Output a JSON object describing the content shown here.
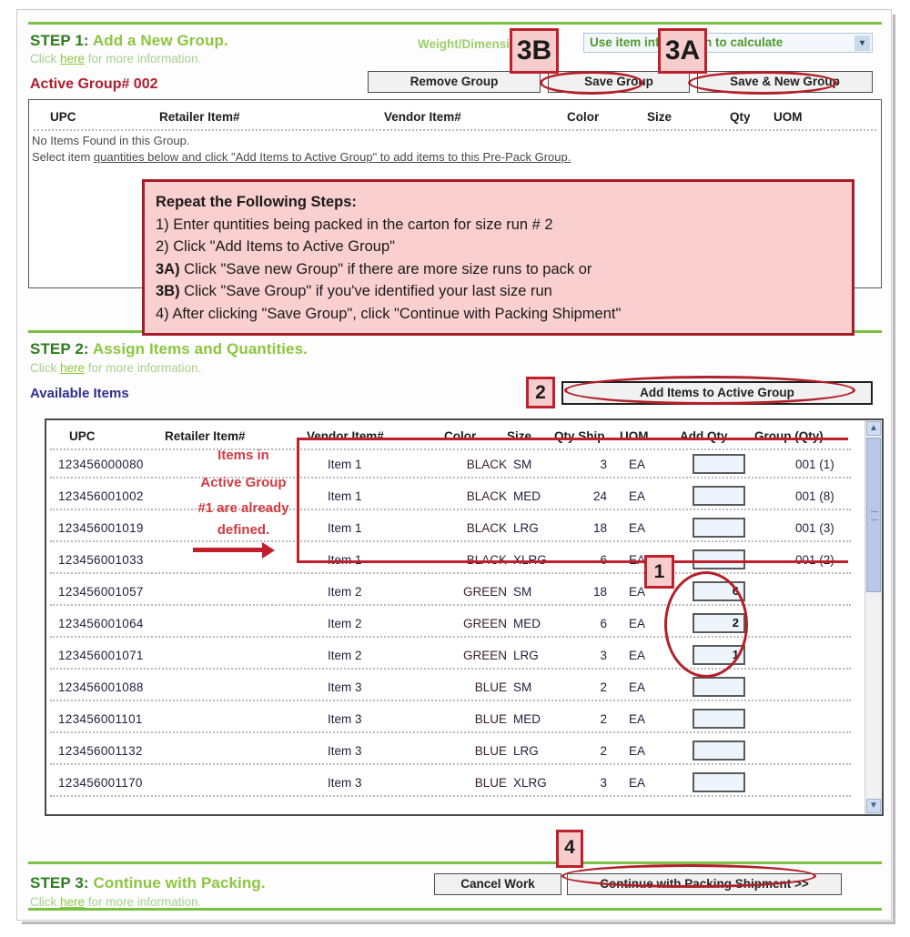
{
  "step1": {
    "heading_prefix": "STEP 1:",
    "heading_text": "Add a New Group.",
    "sub_prefix": "Click ",
    "sub_link": "here",
    "sub_suffix": " for more information.",
    "active_group_label": "Active Group# 002",
    "weight_dims_label": "Weight/Dimensions:",
    "weight_dims_value": "Use item information to calculate",
    "dropdown_arrow": "✓",
    "buttons": {
      "remove_group": "Remove Group",
      "save_group": "Save Group",
      "save_new_group": "Save & New Group"
    },
    "group_table": {
      "columns": [
        "UPC",
        "Retailer Item#",
        "Vendor Item#",
        "Color",
        "Size",
        "Qty",
        "UOM"
      ],
      "empty_line1": "No Items Found in this Group.",
      "empty_line2_a": "Select item ",
      "empty_line2_b": "quantities below and click \"Add Items to Active Group\" to add items to this Pre-Pack Group."
    }
  },
  "callout": {
    "title": "Repeat the Following Steps:",
    "lines": [
      {
        "bold": "1)",
        "text": " Enter quntities being packed in the carton for size run # 2"
      },
      {
        "bold": "2)",
        "text": " Click \"Add Items to Active Group\""
      },
      {
        "bold": "3A)",
        "text": " Click \"Save new Group\" if there are more size runs to pack or"
      },
      {
        "bold": "3B)",
        "text": " Click \"Save Group\" if you've identified your last size run"
      },
      {
        "bold": "4)",
        "text": " After clicking \"Save Group\", click \"Continue with Packing Shipment\""
      }
    ]
  },
  "step2": {
    "heading_prefix": "STEP 2:",
    "heading_text": "Assign Items and Quantities.",
    "sub_prefix": "Click ",
    "sub_link": "here",
    "sub_suffix": " for more information.",
    "available_items_label": "Available Items",
    "add_items_button": "Add Items to Active Group",
    "columns": [
      "UPC",
      "Retailer Item#",
      "Vendor Item#",
      "Color",
      "Size",
      "Qty Ship",
      "UOM",
      "Add Qty",
      "Group (Qty)"
    ],
    "rows": [
      {
        "upc": "123456000080",
        "retailer_item": "",
        "vendor_item": "Item 1",
        "color": "BLACK",
        "size": "SM",
        "qty_ship": "3",
        "uom": "EA",
        "add_qty": "",
        "group_qty": "001 (1)"
      },
      {
        "upc": "123456001002",
        "retailer_item": "",
        "vendor_item": "Item 1",
        "color": "BLACK",
        "size": "MED",
        "qty_ship": "24",
        "uom": "EA",
        "add_qty": "",
        "group_qty": "001 (8)"
      },
      {
        "upc": "123456001019",
        "retailer_item": "",
        "vendor_item": "Item 1",
        "color": "BLACK",
        "size": "LRG",
        "qty_ship": "18",
        "uom": "EA",
        "add_qty": "",
        "group_qty": "001 (3)"
      },
      {
        "upc": "123456001033",
        "retailer_item": "",
        "vendor_item": "Item 1",
        "color": "BLACK",
        "size": "XLRG",
        "qty_ship": "6",
        "uom": "EA",
        "add_qty": "",
        "group_qty": "001 (2)"
      },
      {
        "upc": "123456001057",
        "retailer_item": "",
        "vendor_item": "Item 2",
        "color": "GREEN",
        "size": "SM",
        "qty_ship": "18",
        "uom": "EA",
        "add_qty": "6",
        "group_qty": ""
      },
      {
        "upc": "123456001064",
        "retailer_item": "",
        "vendor_item": "Item 2",
        "color": "GREEN",
        "size": "MED",
        "qty_ship": "6",
        "uom": "EA",
        "add_qty": "2",
        "group_qty": ""
      },
      {
        "upc": "123456001071",
        "retailer_item": "",
        "vendor_item": "Item 2",
        "color": "GREEN",
        "size": "LRG",
        "qty_ship": "3",
        "uom": "EA",
        "add_qty": "1",
        "group_qty": ""
      },
      {
        "upc": "123456001088",
        "retailer_item": "",
        "vendor_item": "Item 3",
        "color": "BLUE",
        "size": "SM",
        "qty_ship": "2",
        "uom": "EA",
        "add_qty": "",
        "group_qty": ""
      },
      {
        "upc": "123456001101",
        "retailer_item": "",
        "vendor_item": "Item 3",
        "color": "BLUE",
        "size": "MED",
        "qty_ship": "2",
        "uom": "EA",
        "add_qty": "",
        "group_qty": ""
      },
      {
        "upc": "123456001132",
        "retailer_item": "",
        "vendor_item": "Item 3",
        "color": "BLUE",
        "size": "LRG",
        "qty_ship": "2",
        "uom": "EA",
        "add_qty": "",
        "group_qty": ""
      },
      {
        "upc": "123456001170",
        "retailer_item": "",
        "vendor_item": "Item 3",
        "color": "BLUE",
        "size": "XLRG",
        "qty_ship": "3",
        "uom": "EA",
        "add_qty": "",
        "group_qty": ""
      }
    ],
    "scrollbar": {
      "up_arrow": "▲",
      "down_arrow": "▼"
    }
  },
  "step3": {
    "heading_prefix": "STEP 3:",
    "heading_text": "Continue with Packing.",
    "sub_prefix": "Click ",
    "sub_link": "here",
    "sub_suffix": " for more information.",
    "cancel_button": "Cancel Work",
    "continue_button": "Continue with Packing Shipment >>"
  },
  "annotations": {
    "badge_1": "1",
    "badge_2": "2",
    "badge_3a": "3A",
    "badge_3b": "3B",
    "badge_4": "4",
    "items_note_line1": "Items in",
    "items_note_line2": "Active Group",
    "items_note_line3": "#1 are already",
    "items_note_line4": "defined."
  },
  "colors": {
    "green_rule": "#7ac143",
    "heading_dark_green": "#2f7d1f",
    "heading_light_green": "#8cc63f",
    "active_group_red": "#b01c2e",
    "annotation_red": "#c0202c",
    "callout_pink": "#f9cfcf",
    "available_items_blue": "#2f2f8f"
  }
}
